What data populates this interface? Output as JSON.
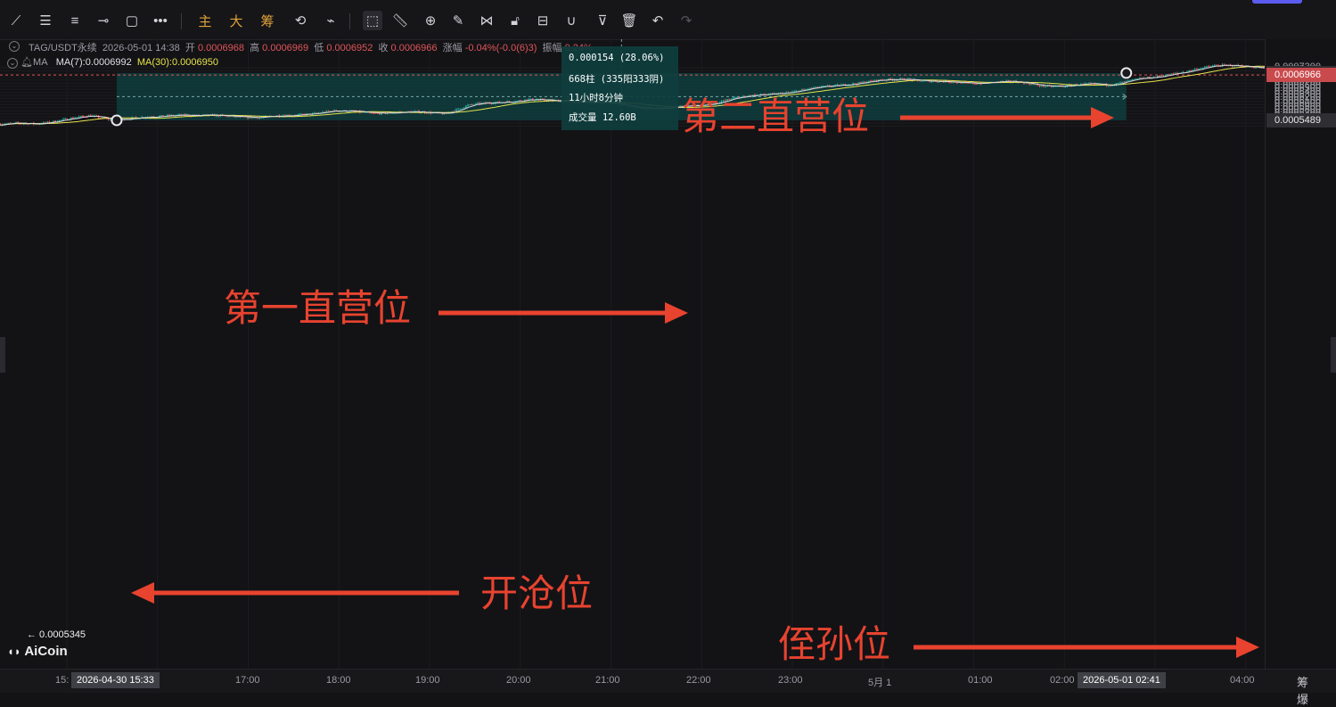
{
  "toolbar": {
    "tools": [
      "trendline-icon",
      "parallel-lines-icon",
      "horizontal-lines-icon",
      "horizontal-ray-icon",
      "rectangle-icon",
      "more-tools-icon"
    ],
    "text_buttons": [
      "主",
      "大",
      "筹"
    ],
    "tools2": [
      "sync-icon",
      "brush-icon",
      "select-icon",
      "ruler-icon",
      "zoom-icon",
      "pen-icon",
      "pattern-icon",
      "lock-icon",
      "template-icon",
      "magnet-icon",
      "filter-icon",
      "trash-icon",
      "undo-icon",
      "redo-icon"
    ]
  },
  "info": {
    "symbol": "TAG/USDT永续",
    "datetime": "2026-05-01 14:38",
    "open_label": "开",
    "open": "0.0006968",
    "high_label": "高",
    "high": "0.0006969",
    "low_label": "低",
    "low": "0.0006952",
    "close_label": "收",
    "close": "0.0006966",
    "change_label": "涨幅",
    "change": "-0.04%(-0.0(6)3)",
    "amp_label": "振幅",
    "amp": "0.24%",
    "ma_label": "MA",
    "ma7": "MA(7):0.0006992",
    "ma30": "MA(30):0.0006950"
  },
  "tooltip": {
    "line1": "0.000154 (28.06%)",
    "line2": "668柱 (335阳333阴)",
    "line3": "11小时8分钟",
    "line4": "成交量 12.60B"
  },
  "annotations": {
    "second": "第二直营位",
    "first": "第一直营位",
    "open": "开沧位",
    "niece": "侄孙位"
  },
  "low_marker": "← 0.0005345",
  "logo": "AiCoin",
  "yaxis": {
    "labels": [
      "0.0007200",
      "0.0007100",
      "0.0006900",
      "0.0006800",
      "0.0006700",
      "0.0006600",
      "0.0006500",
      "0.0006400",
      "0.0006300",
      "0.0006200",
      "0.0006100",
      "0.0006000",
      "0.0005900",
      "0.0005800",
      "0.0005700",
      "0.0005600",
      "0.0005400",
      "0.0005300"
    ],
    "tag_top": "0.0007029",
    "tag_current": "0.0006966",
    "tag_bottom": "0.0005489"
  },
  "xaxis": {
    "labels": [
      "15:",
      "0",
      "17:00",
      "18:00",
      "19:00",
      "20:00",
      "21:00",
      "22:00",
      "23:00",
      "5月 1",
      "01:00",
      "02:00",
      "04:00"
    ],
    "tag_start": "2026-04-30 15:33",
    "tag_end": "2026-05-01 02:41"
  },
  "bottom_right": "筹 爆",
  "colors": {
    "up": "#26a69a",
    "down": "#ef5350",
    "ma7": "#d8d8dc",
    "ma30": "#e8e24a",
    "box": "#0f3d3d",
    "anno": "#e8432f",
    "current": "#e0555a"
  }
}
